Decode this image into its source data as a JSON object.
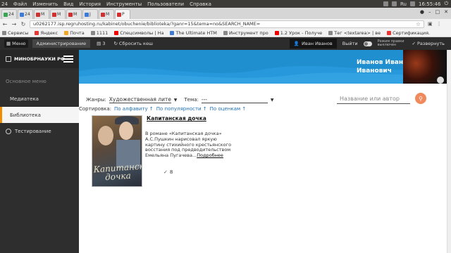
{
  "os": {
    "menu": [
      "24",
      "Файл",
      "Изменить",
      "Вид",
      "История",
      "Инструменты",
      "Пользователи",
      "Справка"
    ],
    "keyboard": "Ru",
    "time": "16:55:46"
  },
  "browser": {
    "tabs": [
      {
        "label": "24",
        "icon": "green-badge-icon"
      },
      {
        "label": "24",
        "icon": "blue-badge-icon"
      },
      {
        "label": "M",
        "icon": "gmail-icon"
      },
      {
        "label": "М",
        "icon": "site-icon"
      },
      {
        "label": "М",
        "icon": "site-icon"
      },
      {
        "label": "J",
        "icon": "site-icon"
      },
      {
        "label": "M",
        "icon": "site-icon"
      },
      {
        "label": "P",
        "icon": "site-icon"
      }
    ],
    "url": "u0262177.isp.regruhosting.ru/kabinet/obuchenie/biblioteka/?ganr=15&tema=no&SEARCH_NAME=",
    "bookmarks": [
      {
        "label": "Сервисы",
        "icon": "apps-icon"
      },
      {
        "label": "Яндекс",
        "icon": "yandex-icon"
      },
      {
        "label": "Почта",
        "icon": "mail-icon"
      },
      {
        "label": "1111",
        "icon": "bookmark-icon"
      },
      {
        "label": "Спецсимволы | Ha",
        "icon": "youtube-icon"
      },
      {
        "label": "The Ultimate HTM",
        "icon": "site-icon"
      },
      {
        "label": "Инструмент про",
        "icon": "site-icon"
      },
      {
        "label": "1.2 Урок - Получе",
        "icon": "youtube-icon"
      },
      {
        "label": "Тег <textarea> | ве",
        "icon": "site-icon"
      },
      {
        "label": "Сертификация.",
        "icon": "site-icon"
      }
    ]
  },
  "admin_bar": {
    "menu": "Меню",
    "admin": "Администрирование",
    "count": "3",
    "clear_cache": "Сбросить кеш",
    "user": "Иван Иванов",
    "logout": "Выйти",
    "mode_line1": "Режим правки",
    "mode_line2": "выключен",
    "expand": "Развернуть"
  },
  "sidebar": {
    "brand": "МИНОБРНАУКИ РФ",
    "section": "Основное меню",
    "items": [
      {
        "label": "Медиатека"
      },
      {
        "label": "Библиотека"
      },
      {
        "label": "Тестирование"
      }
    ]
  },
  "header": {
    "user_line1": "Иванов Иван",
    "user_line2": "Иванович"
  },
  "filters": {
    "genre_label": "Жанры:",
    "genre_value": "Художественная литер",
    "theme_label": "Тема:",
    "theme_value": "---",
    "search_placeholder": "Название или автор",
    "sort_label": "Сортировка:",
    "sort_alpha": "По алфавиту ↑",
    "sort_popular": "По популярности ↑",
    "sort_rating": "По оценкам ↑"
  },
  "book": {
    "title": "Капитанская дочка",
    "cover_text": "Капитанская дочка",
    "description": "В романе «Капитанская дочка» А.С.Пушкин нарисовал яркую картину стихийного крестьянского восстания под предводительством Емельяна Пугачева...",
    "more": "Подробнее",
    "rating": "8"
  }
}
